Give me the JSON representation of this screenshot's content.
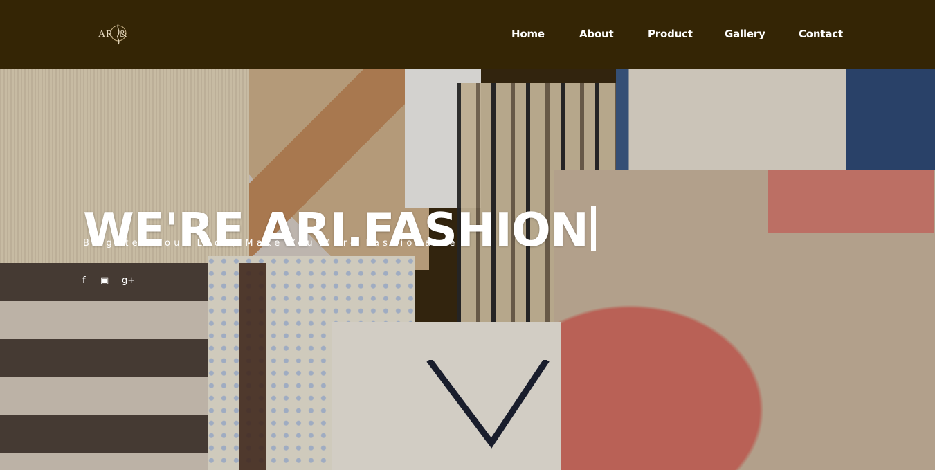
{
  "brand": {
    "logo_text": "AR .&"
  },
  "nav": {
    "items": [
      {
        "label": "Home"
      },
      {
        "label": "About"
      },
      {
        "label": "Product"
      },
      {
        "label": "Gallery"
      },
      {
        "label": "Contact"
      }
    ]
  },
  "hero": {
    "title": "WE'RE ARI.FASHION",
    "subtitle": "Brighten Your Look, Make You More Fashionable",
    "social": [
      {
        "icon": "facebook-icon",
        "glyph": "f"
      },
      {
        "icon": "instagram-icon",
        "glyph": "▣"
      },
      {
        "icon": "google-plus-icon",
        "glyph": "g+"
      }
    ]
  },
  "colors": {
    "navbar": "#342505",
    "text": "#ffffff"
  }
}
